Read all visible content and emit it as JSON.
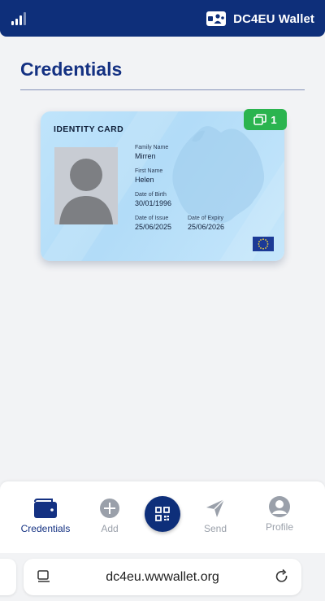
{
  "status": {
    "signal_icon": "signal-bars-icon"
  },
  "header": {
    "brand_name": "DC4EU Wallet",
    "logo_icon": "wallet-logo-icon",
    "background": "#0e2f7a"
  },
  "page": {
    "title": "Credentials"
  },
  "credential_card": {
    "title": "IDENTITY CARD",
    "count_badge": "1",
    "count_icon": "stack-icon",
    "badge_color": "#2bb44f",
    "fields": {
      "family_name_label": "Family Name",
      "family_name": "Mirren",
      "first_name_label": "First Name",
      "first_name": "Helen",
      "date_of_birth_label": "Date of Birth",
      "date_of_birth": "30/01/1996",
      "date_of_issue_label": "Date of Issue",
      "date_of_issue": "25/06/2025",
      "date_of_expiry_label": "Date of Expiry",
      "date_of_expiry": "25/06/2026"
    }
  },
  "bottom_nav": {
    "items": [
      {
        "label": "Credentials",
        "icon": "wallet-icon",
        "active": true
      },
      {
        "label": "Add",
        "icon": "plus-circle-icon",
        "active": false
      },
      {
        "label": "",
        "icon": "qr-scan-icon",
        "active": false
      },
      {
        "label": "Send",
        "icon": "send-icon",
        "active": false
      },
      {
        "label": "Profile",
        "icon": "user-circle-icon",
        "active": false
      }
    ],
    "active_color": "#143182"
  },
  "browser": {
    "url": "dc4eu.wwwallet.org",
    "left_icon": "tab-menu-icon",
    "reload_icon": "reload-icon"
  }
}
